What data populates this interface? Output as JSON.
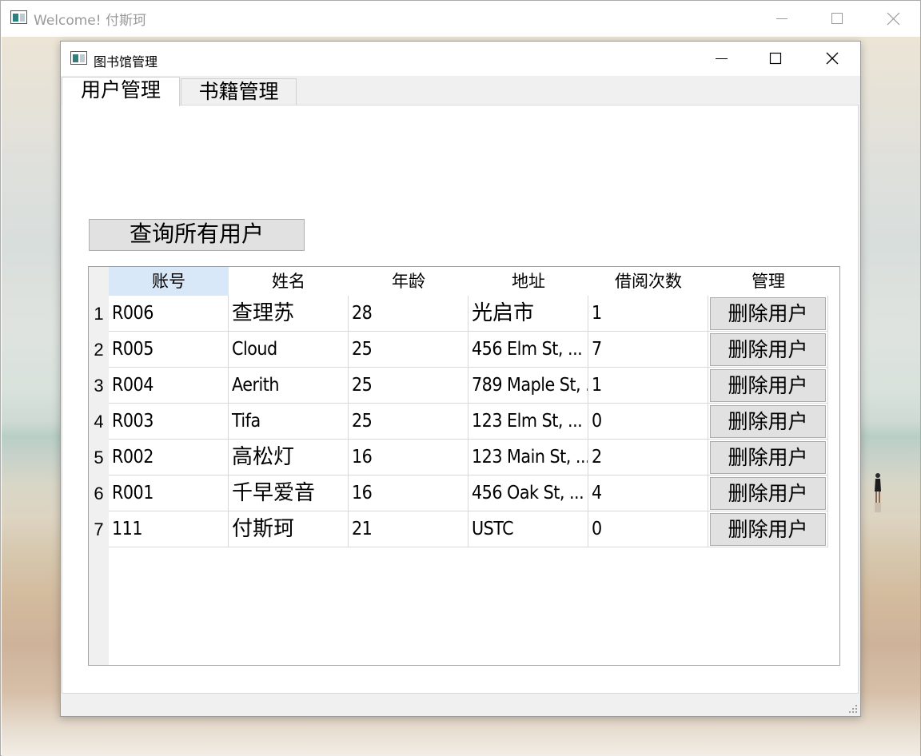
{
  "outer_window": {
    "title": "Welcome! 付斯珂"
  },
  "child_window": {
    "title": "图书馆管理"
  },
  "tabs": [
    {
      "label": "用户管理",
      "active": true
    },
    {
      "label": "书籍管理",
      "active": false
    }
  ],
  "users_page": {
    "query_button": "查询所有用户",
    "table": {
      "headers": [
        "账号",
        "姓名",
        "年龄",
        "地址",
        "借阅次数",
        "管理"
      ],
      "selected_header": "账号",
      "rows": [
        {
          "num": "1",
          "account": "R006",
          "name": "查理苏",
          "age": "28",
          "address": "光启市",
          "borrow_count": "1",
          "action": "删除用户"
        },
        {
          "num": "2",
          "account": "R005",
          "name": "Cloud",
          "age": "25",
          "address": "456 Elm St, ...",
          "borrow_count": "7",
          "action": "删除用户"
        },
        {
          "num": "3",
          "account": "R004",
          "name": "Aerith",
          "age": "25",
          "address": "789 Maple St, ...",
          "borrow_count": "1",
          "action": "删除用户"
        },
        {
          "num": "4",
          "account": "R003",
          "name": "Tifa",
          "age": "25",
          "address": "123 Elm St, ...",
          "borrow_count": "0",
          "action": "删除用户"
        },
        {
          "num": "5",
          "account": "R002",
          "name": "高松灯",
          "age": "16",
          "address": "123 Main St, ...",
          "borrow_count": "2",
          "action": "删除用户"
        },
        {
          "num": "6",
          "account": "R001",
          "name": "千早爱音",
          "age": "16",
          "address": "456 Oak St, ...",
          "borrow_count": "4",
          "action": "删除用户"
        },
        {
          "num": "7",
          "account": "111",
          "name": "付斯珂",
          "age": "21",
          "address": "USTC",
          "borrow_count": "0",
          "action": "删除用户"
        }
      ]
    }
  },
  "colors": {
    "selected_header": "#d9e8f8",
    "button_face": "#e1e1e1",
    "button_border": "#adadad"
  }
}
